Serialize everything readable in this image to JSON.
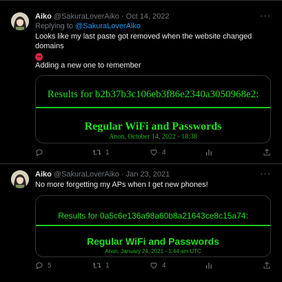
{
  "tweets": [
    {
      "display_name": "Aiko",
      "handle": "@SakuraLoverAiko",
      "separator": "·",
      "date": "Oct 14, 2022",
      "more": "···",
      "reply_prefix": "Replying to ",
      "reply_mention": "@SakuraLoverAiko",
      "text_line1": "Looks like my last paste got removed when the website changed domains",
      "text_line2": "Adding a new one to remember",
      "card": {
        "title": "Results for b2b37b3c106eb3f86e2340a3050968e2:",
        "heading": "Regular WiFi and Passwords",
        "subtitle": "Anon, October 14, 2022 - 18:38"
      },
      "actions": {
        "replies": "",
        "retweets": "1",
        "likes": "4",
        "views": ""
      },
      "emoji_icon": "angry-face-icon"
    },
    {
      "display_name": "Aiko",
      "handle": "@SakuraLoverAiko",
      "separator": "·",
      "date": "Jan 23, 2021",
      "more": "···",
      "text_line1": "No more forgetting my APs when I get new phones!",
      "card": {
        "title": "Results for 0a5c6e136a98a60b8a21643ce8c15a74:",
        "heading": "Regular WiFi and Passwords",
        "subtitle": "Anon, January 24, 2021 - 1:44 am UTC"
      },
      "actions": {
        "replies": "5",
        "retweets": "1",
        "likes": "4",
        "views": ""
      }
    }
  ],
  "icons": {
    "reply": "reply-bubble-icon",
    "retweet": "retweet-icon",
    "like": "heart-icon",
    "views": "views-bar-chart-icon",
    "share": "share-upload-icon"
  },
  "colors": {
    "background": "#000000",
    "text": "#e7e9ea",
    "muted": "#71767b",
    "link": "#1d9bf0",
    "terminal_green": "#1fe01f",
    "border": "#2f3336"
  }
}
